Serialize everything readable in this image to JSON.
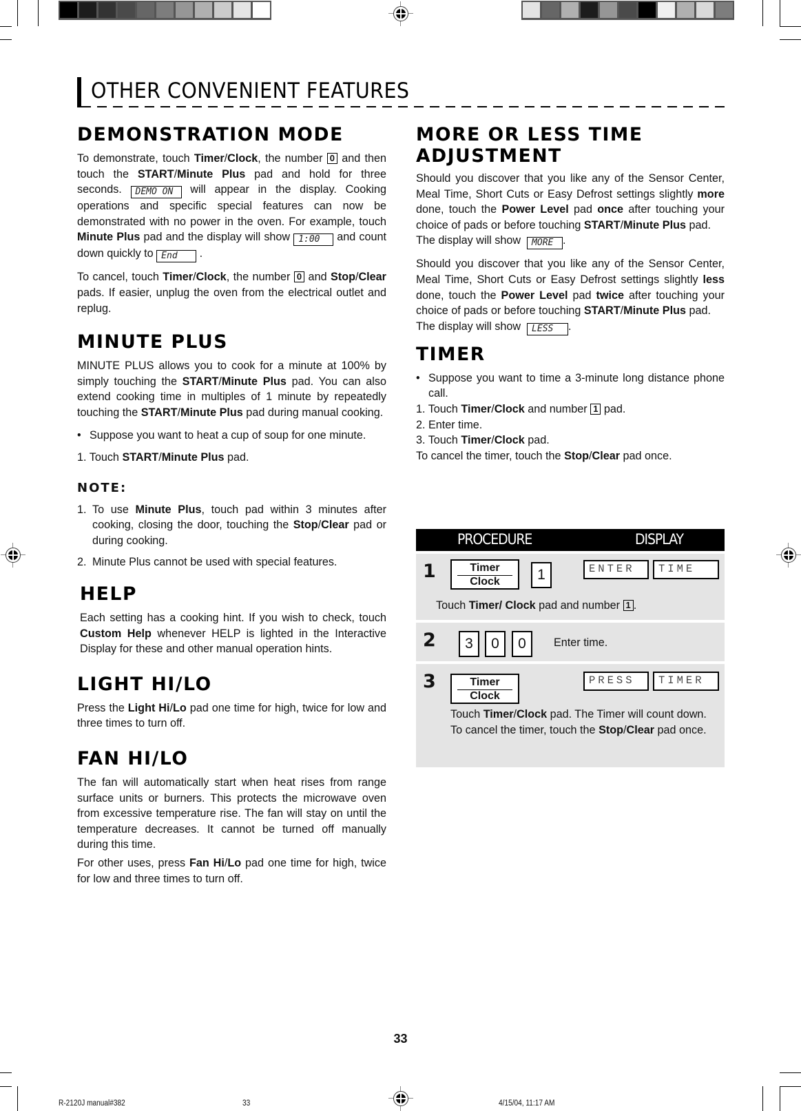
{
  "page": {
    "title": "OTHER CONVENIENT FEATURES",
    "page_number": "33"
  },
  "print_marks": {
    "left_colorbar": [
      "#000000",
      "#1c1c1c",
      "#333333",
      "#4a4a4a",
      "#666666",
      "#7d7d7d",
      "#969696",
      "#b0b0b0",
      "#cbcbcb",
      "#e4e4e4",
      "#ffffff"
    ],
    "right_colorbar": [
      "#e4e4e4",
      "#666666",
      "#b0b0b0",
      "#1c1c1c",
      "#969696",
      "#4a4a4a",
      "#000000",
      "#f0f0f0",
      "#b0b0b0",
      "#d9d9d9",
      "#7d7d7d"
    ],
    "slug": {
      "file": "R-2120J manual#382",
      "page": "33",
      "timestamp": "4/15/04, 11:17 AM"
    }
  },
  "demo": {
    "heading": "DEMONSTRATION MODE",
    "p1": {
      "a": "To demonstrate, touch ",
      "b1": "Timer",
      "s1": "/",
      "b2": "Clock",
      "c": ", the number ",
      "key": "0",
      "d": " and then touch the ",
      "b3": "START",
      "s2": "/",
      "b4": "Minute Plus",
      "e": " pad and hold for three seconds. ",
      "lcd1": "DEMO ON",
      "f": " will appear in the display. Cooking operations and specific special features can now be demonstrated with no power in the oven. For example, touch ",
      "b5": "Minute Plus",
      "g": " pad and the display will show ",
      "lcd2": "1:00",
      "h": " and count down quickly to ",
      "lcd3": "End",
      "i": " ."
    },
    "p2": {
      "a": "To cancel, touch ",
      "b1": "Timer",
      "s1": "/",
      "b2": "Clock",
      "c": ", the number ",
      "key": "0",
      "d": " and ",
      "b3": "Stop",
      "s2": "/",
      "b4": "Clear",
      "e": " pads. If easier, unplug the oven from the electrical outlet and replug."
    }
  },
  "minute_plus": {
    "heading": "MINUTE PLUS",
    "p1": {
      "a": "MINUTE PLUS allows you to cook for a minute at 100% by simply touching the ",
      "b1": "START",
      "s1": "/",
      "b2": "Minute Plus",
      "c": " pad. You can also extend cooking time in multiples of 1 minute by repeatedly touching the ",
      "b3": "START",
      "s2": "/",
      "b4": "Minute Plus",
      "d": " pad during manual cooking."
    },
    "bullet": "Suppose you want to heat a cup of soup for one minute.",
    "step1": {
      "num": "1.",
      "a": "Touch ",
      "b1": "START",
      "s1": "/",
      "b2": "Minute Plus",
      "c": " pad."
    },
    "note_heading": "NOTE:",
    "notes": [
      {
        "num": "1.",
        "a": "To use ",
        "b1": "Minute Plus",
        "c": ", touch pad within 3 minutes after cooking, closing the door, touching the ",
        "b2": "Stop",
        "s1": "/",
        "b3": "Clear",
        "d": " pad or during cooking."
      },
      {
        "num": "2.",
        "text": "Minute Plus cannot be used with special features."
      }
    ]
  },
  "help": {
    "heading": "HELP",
    "a": "Each setting has a cooking hint. If you wish to check, touch ",
    "b1": "Custom Help",
    "c": " whenever HELP is lighted in the Interactive Display for these and other manual operation hints."
  },
  "light": {
    "heading": "LIGHT HI/LO",
    "a": "Press the ",
    "b1": "Light Hi",
    "s1": "/",
    "b2": "Lo",
    "c": " pad one time for high, twice for low and three times to turn off."
  },
  "fan": {
    "heading": "FAN HI/LO",
    "p1": "The fan will automatically start when heat rises from range surface units or burners. This protects the microwave oven from excessive temperature rise. The fan will stay on until the temperature decreases. It cannot be turned off manually during this time.",
    "p2": {
      "a": "For other uses, press ",
      "b1": "Fan Hi",
      "s1": "/",
      "b2": "Lo",
      "c": " pad one time for high, twice for low and three times to turn off."
    }
  },
  "more_less": {
    "heading_line1": "MORE OR LESS TIME",
    "heading_line2": "ADJUSTMENT",
    "more": {
      "a": "Should you discover that you like any of the Sensor Center, Meal Time, Short Cuts or Easy Defrost settings slightly ",
      "b1": "more",
      "c": " done, touch the ",
      "b2": "Power Level",
      "d": " pad ",
      "b3": "once",
      "e": " after touching your choice of pads or before touching ",
      "b4": "START",
      "s1": "/",
      "b5": "Minute Plus",
      "f": " pad.",
      "show": "The display will show ",
      "lcd": "MORE",
      "end": "."
    },
    "less": {
      "a": "Should you discover that you like any of the Sensor Center, Meal Time, Short Cuts or Easy Defrost settings slightly ",
      "b1": "less",
      "c": " done, touch the ",
      "b2": "Power Level",
      "d": " pad ",
      "b3": "twice",
      "e": " after touching your choice of pads or before touching ",
      "b4": "START",
      "s1": "/",
      "b5": "Minute Plus",
      "f": " pad.",
      "show": "The display will show ",
      "lcd": "LESS",
      "end": "."
    }
  },
  "timer": {
    "heading": "TIMER",
    "bullet": "Suppose you want to time a 3-minute long distance phone call.",
    "s1": {
      "a": "1. Touch ",
      "b1": "Timer",
      "sl": "/",
      "b2": "Clock",
      "c": " and number ",
      "key": "1",
      "d": " pad."
    },
    "s2": "2. Enter time.",
    "s3": {
      "a": "3. Touch ",
      "b1": "Timer",
      "sl": "/",
      "b2": "Clock",
      "c": " pad."
    },
    "cancel": {
      "a": "To cancel the timer, touch the ",
      "b1": "Stop",
      "sl": "/",
      "b2": "Clear",
      "c": " pad once."
    }
  },
  "procedure": {
    "header_left": "PROCEDURE",
    "header_right": "DISPLAY",
    "steps": [
      {
        "num": "1",
        "pad_top": "Timer",
        "pad_bottom": "Clock",
        "key": "1",
        "display": [
          "ENTER",
          "TIME"
        ],
        "text": {
          "a": "Touch ",
          "b1": "Timer/",
          "sp": " ",
          "b2": "Clock",
          "c": " pad and number ",
          "key": "1",
          "d": "."
        }
      },
      {
        "num": "2",
        "keys": [
          "3",
          "0",
          "0"
        ],
        "text": "Enter time."
      },
      {
        "num": "3",
        "pad_top": "Timer",
        "pad_bottom": "Clock",
        "display": [
          "PRESS",
          "TIMER"
        ],
        "text": {
          "a": "Touch ",
          "b1": "Timer",
          "s1": "/",
          "b2": "Clock",
          "c": " pad. The Timer will count down. To cancel the timer, touch the ",
          "b3": "Stop",
          "s2": "/",
          "b4": "Clear",
          "d": " pad once."
        }
      }
    ]
  }
}
